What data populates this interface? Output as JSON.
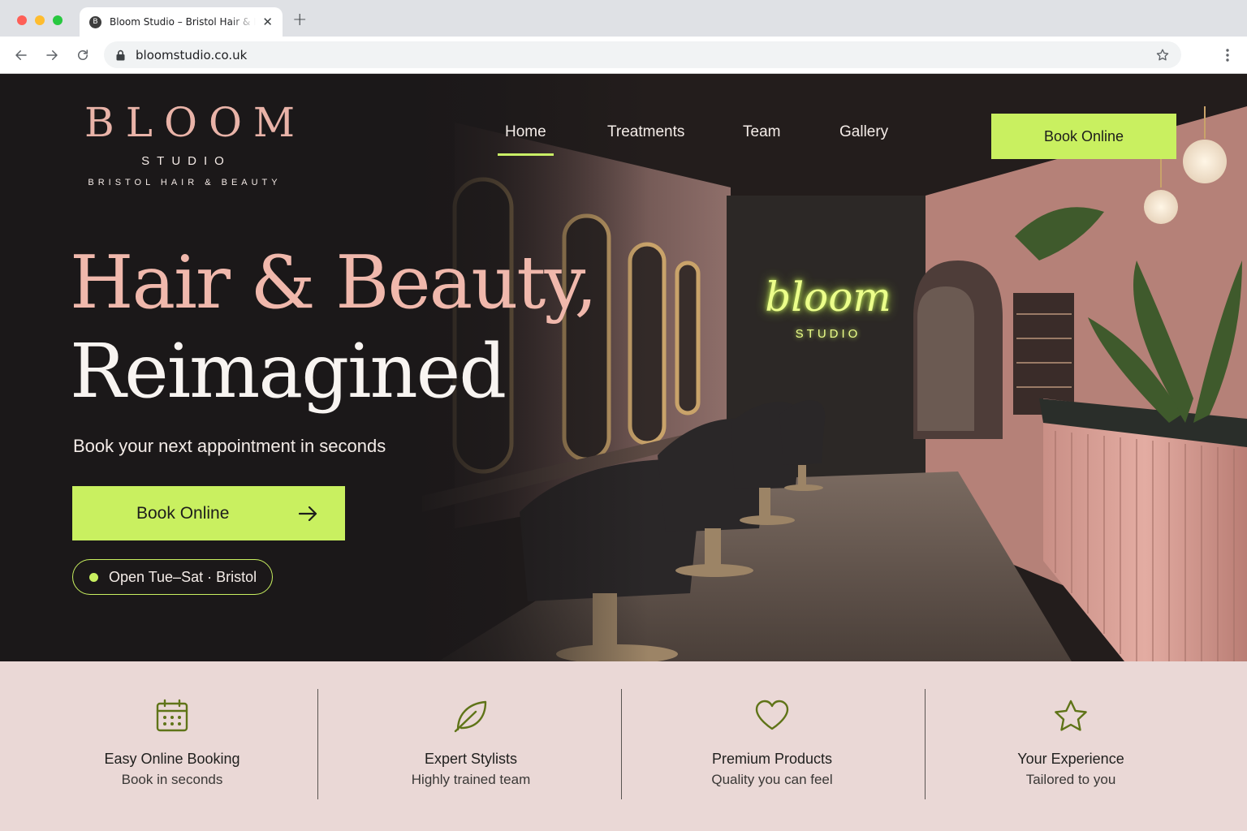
{
  "browser": {
    "tab_title": "Bloom Studio – Bristol Hair & Beauty",
    "favicon_letter": "B",
    "url": "bloomstudio.co.uk",
    "icons": [
      "back-icon",
      "forward-icon",
      "reload-icon",
      "lock-icon",
      "star-icon",
      "menu-dots-icon",
      "close-icon",
      "new-tab-icon"
    ]
  },
  "brand": {
    "name": "BLOOM",
    "sub": "STUDIO",
    "tagline": "BRISTOL HAIR & BEAUTY"
  },
  "nav": {
    "items": [
      {
        "label": "Home",
        "active": true
      },
      {
        "label": "Treatments"
      },
      {
        "label": "Team"
      },
      {
        "label": "Gallery"
      }
    ],
    "cta": "Book Online"
  },
  "hero": {
    "headline_line1": "Hair & Beauty,",
    "headline_line2": "Reimagined",
    "subheading": "Book your next appointment in seconds",
    "cta": "Book Online",
    "status": "Open Tue–Sat · Bristol",
    "neon_sign": {
      "script": "bloom",
      "caption": "STUDIO"
    }
  },
  "features": [
    {
      "icon": "calendar-icon",
      "title": "Easy Online Booking",
      "description": "Book in seconds"
    },
    {
      "icon": "leaf-icon",
      "title": "Expert Stylists",
      "description": "Highly trained team"
    },
    {
      "icon": "heart-icon",
      "title": "Premium Products",
      "description": "Quality you can feel"
    },
    {
      "icon": "star-icon",
      "title": "Your Experience",
      "description": "Tailored to you"
    }
  ],
  "colors": {
    "accent_lime": "#c9f060",
    "brand_pink": "#f0b8ac",
    "hero_dark": "#1b1819",
    "feature_bg": "#ead8d6",
    "icon_olive": "#5f7418"
  }
}
